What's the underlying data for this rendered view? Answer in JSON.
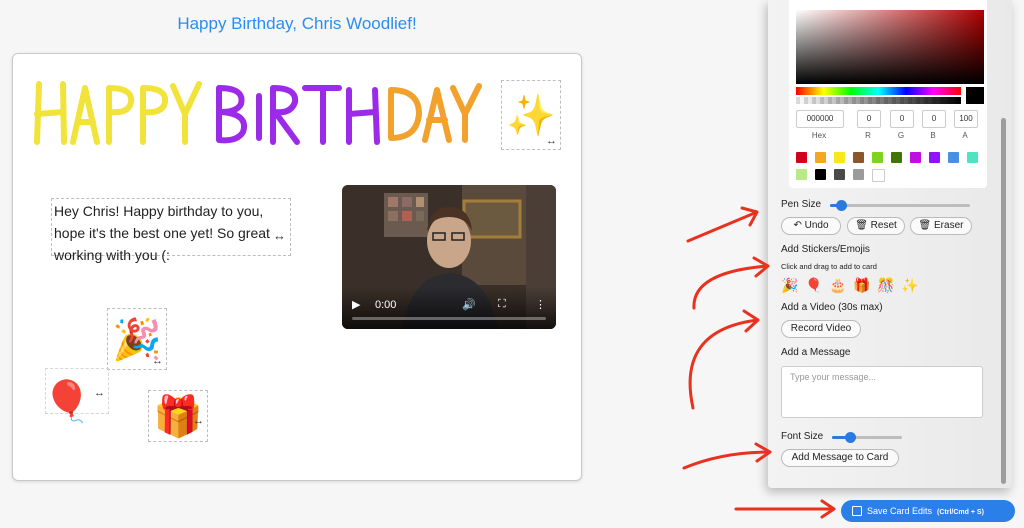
{
  "page": {
    "title": "Happy Birthday, Chris Woodlief!"
  },
  "card": {
    "drawing_text": "HAPPY BIRTHDAY",
    "message": "Hey Chris! Happy birthday to you, hope it's the best one yet! So great working with you (:",
    "resize_symbol": "↔",
    "stickers": [
      {
        "name": "sparkles",
        "emoji": "✨"
      },
      {
        "name": "party-popper",
        "emoji": "🎉"
      },
      {
        "name": "balloon",
        "emoji": "🎈"
      },
      {
        "name": "gift",
        "emoji": "🎁"
      }
    ],
    "video": {
      "time": "0:00",
      "progress": 0
    }
  },
  "panel": {
    "color_picker": {
      "hex": "000000",
      "r": "0",
      "g": "0",
      "b": "0",
      "a": "100",
      "labels": {
        "hex": "Hex",
        "r": "R",
        "g": "G",
        "b": "B",
        "a": "A"
      },
      "swatches": [
        "#d0021b",
        "#f5a623",
        "#f8e71c",
        "#8b572a",
        "#7ed321",
        "#417505",
        "#bd10e0",
        "#9013fe",
        "#4a90e2",
        "#50e3c2",
        "#b8e986",
        "#000000",
        "#4a4a4a",
        "#9b9b9b",
        "#ffffff"
      ]
    },
    "pen_size": {
      "label": "Pen Size",
      "value": 0.08
    },
    "buttons": {
      "undo": "Undo",
      "reset": "Reset",
      "eraser": "Eraser"
    },
    "stickers": {
      "label": "Add Stickers/Emojis",
      "hint": "Click and drag to add to card",
      "emojis": [
        "🎉",
        "🎈",
        "🎂",
        "🎁",
        "🎊",
        "✨"
      ]
    },
    "video": {
      "label": "Add a Video (30s max)",
      "record": "Record Video"
    },
    "message": {
      "label": "Add a Message",
      "placeholder": "Type your message..."
    },
    "font_size": {
      "label": "Font Size",
      "value": 0.25
    },
    "add_message": "Add Message to Card"
  },
  "save": {
    "label": "Save Card Edits",
    "shortcut": "(Ctrl/Cmd + S)"
  },
  "colors": {
    "accent": "#2a80e8",
    "title": "#2a8ef0",
    "arrow": "#e8321e"
  }
}
